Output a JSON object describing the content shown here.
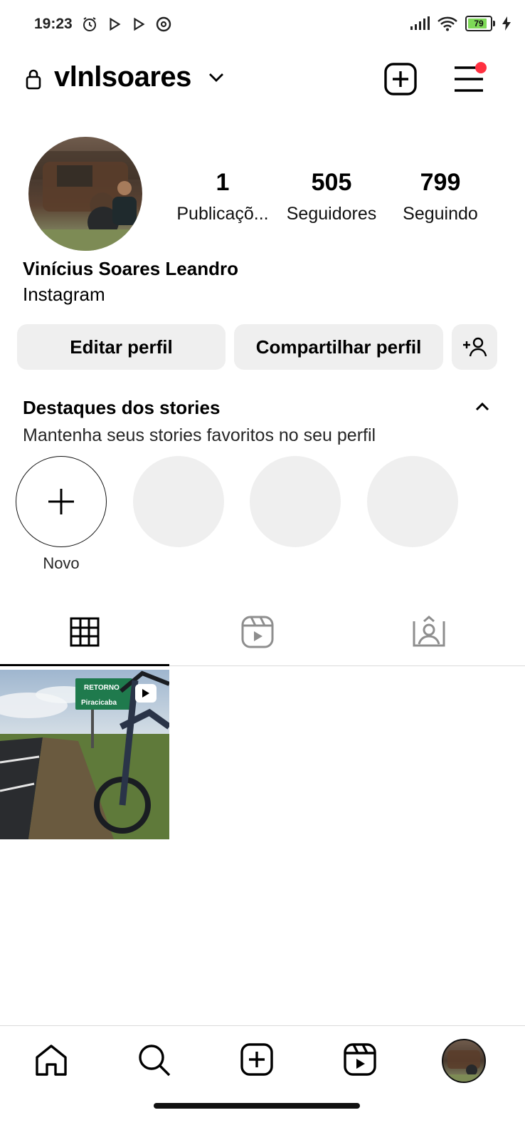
{
  "status_bar": {
    "time": "19:23",
    "battery": "79"
  },
  "header": {
    "username": "vlnlsoares"
  },
  "profile": {
    "stats": [
      {
        "value": "1",
        "label": "Publicaçõ..."
      },
      {
        "value": "505",
        "label": "Seguidores"
      },
      {
        "value": "799",
        "label": "Seguindo"
      }
    ],
    "full_name": "Vinícius Soares Leandro",
    "bio": "Instagram"
  },
  "actions": {
    "edit_label": "Editar perfil",
    "share_label": "Compartilhar perfil"
  },
  "highlights": {
    "title": "Destaques dos stories",
    "subtitle": "Mantenha seus stories favoritos no seu perfil",
    "new_label": "Novo"
  },
  "post": {
    "sign_line1": "RETORNO",
    "sign_line2": "Piracicaba"
  },
  "icons": {
    "add_post": "plus-square-icon",
    "menu": "hamburger-menu-icon",
    "grid_tab": "grid-icon",
    "reels_tab": "reels-icon",
    "tagged_tab": "tagged-icon",
    "nav_home": "home-icon",
    "nav_search": "search-icon",
    "nav_create": "plus-square-icon",
    "nav_reels": "reels-icon"
  },
  "colors": {
    "notification_dot": "#ff3040",
    "button_bg": "#efefef"
  }
}
